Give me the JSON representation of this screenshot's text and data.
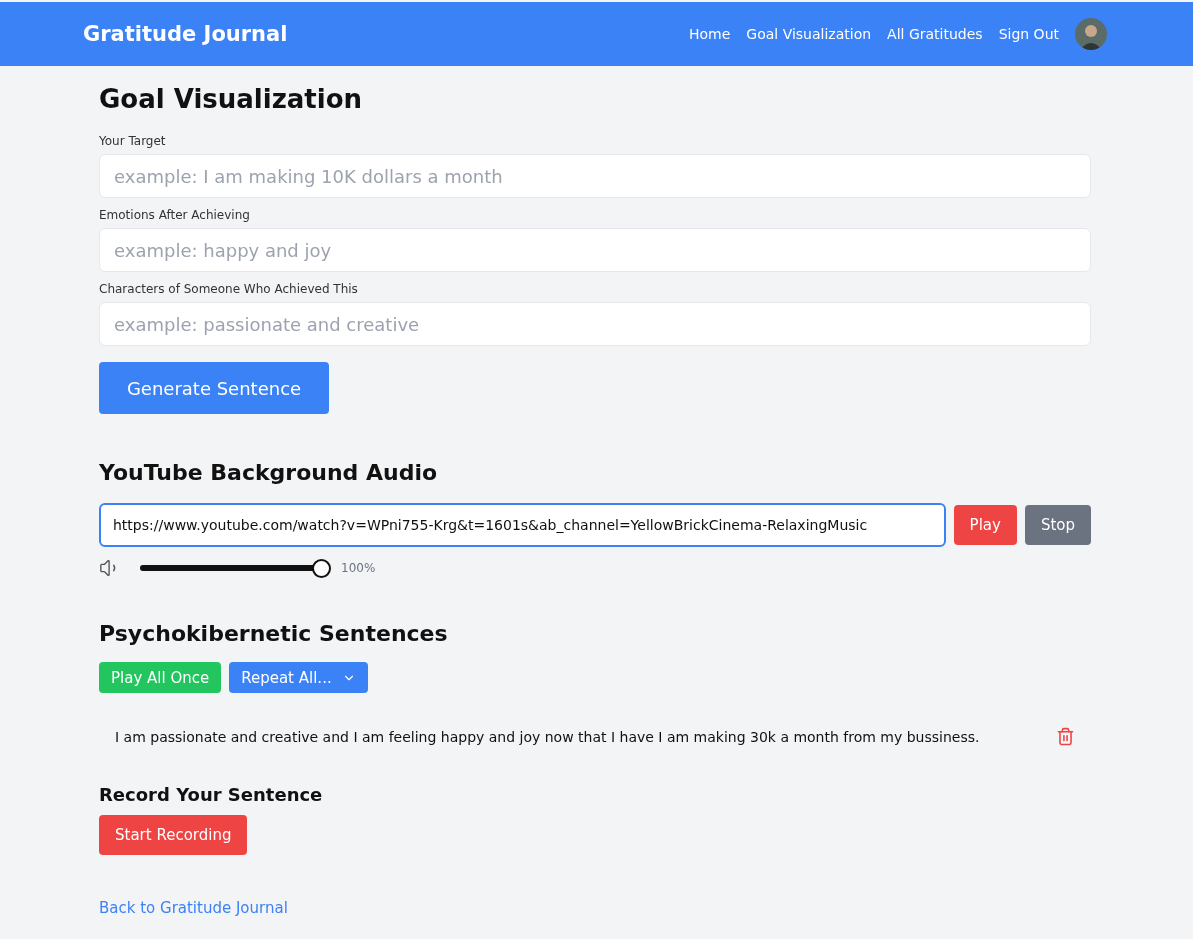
{
  "header": {
    "brand": "Gratitude Journal",
    "nav": [
      {
        "label": "Home"
      },
      {
        "label": "Goal Visualization"
      },
      {
        "label": "All Gratitudes"
      },
      {
        "label": "Sign Out"
      }
    ]
  },
  "page_title": "Goal Visualization",
  "fields": [
    {
      "label": "Your Target",
      "placeholder": "example: I am making 10K dollars a month"
    },
    {
      "label": "Emotions After Achieving",
      "placeholder": "example: happy and joy"
    },
    {
      "label": "Characters of Someone Who Achieved This",
      "placeholder": "example: passionate and creative"
    }
  ],
  "generate_button": "Generate Sentence",
  "audio": {
    "title": "YouTube Background Audio",
    "url": "https://www.youtube.com/watch?v=WPni755-Krg&t=1601s&ab_channel=YellowBrickCinema-RelaxingMusic",
    "focused": true,
    "play": "Play",
    "stop": "Stop",
    "volume": {
      "level": 1,
      "reading": "100%"
    }
  },
  "sentences": {
    "title": "Psychokibernetic Sentences",
    "play_all": "Play All Once",
    "repeat": "Repeat All...",
    "items": [
      {
        "text": "I am passionate and creative and I am feeling happy and joy now that I have I am making 30k a month from my bussiness."
      }
    ]
  },
  "record": {
    "title": "Record Your Sentence",
    "button": "Start Recording"
  },
  "back_link": "Back to Gratitude Journal"
}
